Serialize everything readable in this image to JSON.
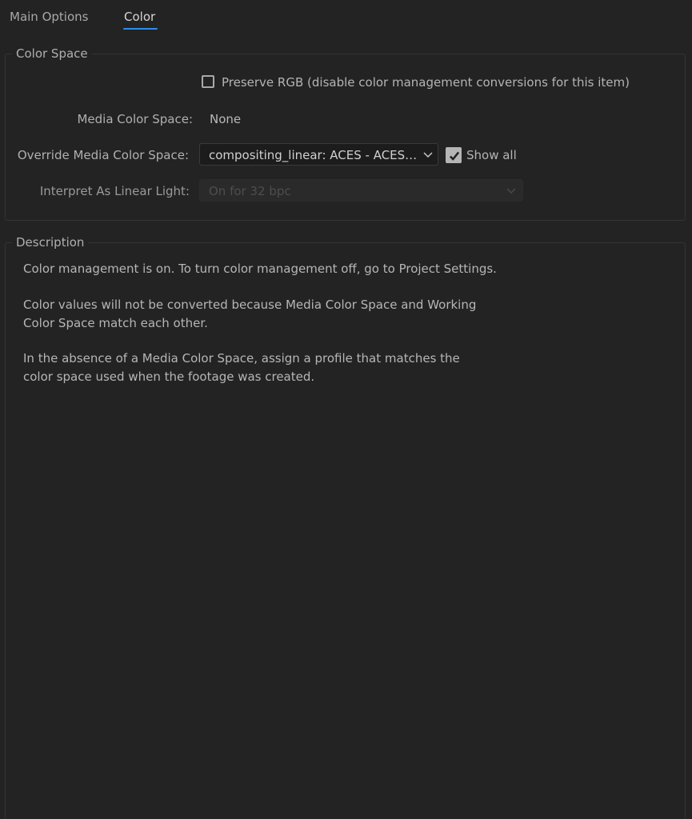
{
  "tabs": [
    {
      "label": "Main Options",
      "active": false
    },
    {
      "label": "Color",
      "active": true
    }
  ],
  "color_space": {
    "title": "Color Space",
    "preserve_rgb": {
      "label": "Preserve RGB (disable color management conversions for this item)",
      "checked": false
    },
    "media_color_space": {
      "label": "Media Color Space:",
      "value": "None"
    },
    "override_media_color_space": {
      "label": "Override Media Color Space:",
      "value": "compositing_linear: ACES - ACES…",
      "icon": "chevron-down-icon"
    },
    "show_all": {
      "label": "Show all",
      "checked": true
    },
    "interpret_as_linear_light": {
      "label": "Interpret As Linear Light:",
      "value": "On for 32 bpc",
      "disabled": true,
      "icon": "chevron-down-icon"
    }
  },
  "description": {
    "title": "Description",
    "paragraphs": [
      "Color management is on. To turn color management off, go to Project Settings.",
      "Color values will not be converted because Media Color Space and Working Color Space match each other.",
      "In the absence of a Media Color Space, assign a profile that matches the color space used when the footage was created."
    ]
  },
  "colors": {
    "background": "#232323",
    "accent": "#2d8ceb",
    "text": "#b4b4b4",
    "disabled_text": "#4e4e4e"
  }
}
